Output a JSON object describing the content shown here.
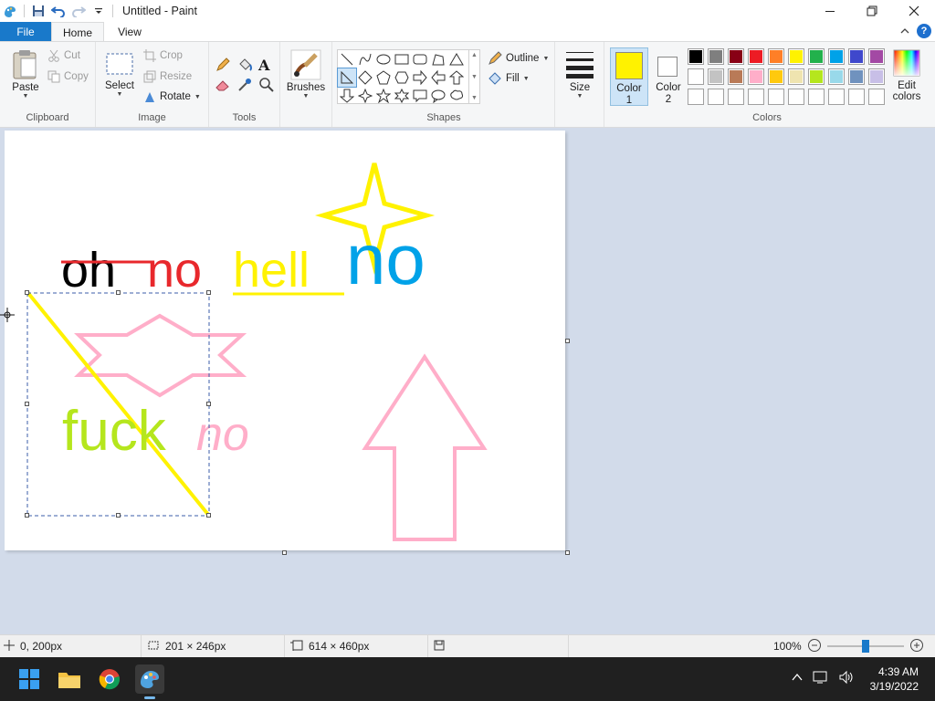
{
  "title_bar": {
    "title": "Untitled - Paint",
    "icons": [
      "paint-app-icon",
      "save-icon",
      "undo-icon",
      "redo-icon",
      "customize-qat-icon"
    ],
    "window_buttons": [
      "minimize-icon",
      "maximize-icon",
      "close-icon"
    ]
  },
  "tabs": {
    "file": "File",
    "home": "Home",
    "view": "View"
  },
  "ribbon": {
    "clipboard": {
      "label": "Clipboard",
      "paste": "Paste",
      "cut": "Cut",
      "copy": "Copy"
    },
    "image": {
      "label": "Image",
      "select": "Select",
      "crop": "Crop",
      "resize": "Resize",
      "rotate": "Rotate"
    },
    "tools": {
      "label": "Tools"
    },
    "brushes": {
      "label": "Brushes"
    },
    "shapes": {
      "label": "Shapes",
      "outline": "Outline",
      "fill": "Fill"
    },
    "size": {
      "label": "Size"
    },
    "colors": {
      "label": "Colors",
      "color1": "Color",
      "color1_num": "1",
      "color2": "Color",
      "color2_num": "2",
      "color1_value": "#fff200",
      "color2_value": "#ffffff",
      "edit": "Edit",
      "edit2": "colors",
      "palette_row1": [
        "#000000",
        "#7f7f7f",
        "#880015",
        "#ed1c24",
        "#ff7f27",
        "#fff200",
        "#22b14c",
        "#00a2e8",
        "#3f48cc",
        "#a349a4"
      ],
      "palette_row2": [
        "#ffffff",
        "#c3c3c3",
        "#b97a57",
        "#ffaec9",
        "#ffc90e",
        "#efe4b0",
        "#b5e61d",
        "#99d9ea",
        "#7092be",
        "#c8bfe7"
      ],
      "palette_row3": [
        "#ffffff",
        "#ffffff",
        "#ffffff",
        "#ffffff",
        "#ffffff",
        "#ffffff",
        "#ffffff",
        "#ffffff",
        "#ffffff",
        "#ffffff"
      ]
    }
  },
  "canvas_text": {
    "w1": "oh",
    "w2": "no",
    "w3": "hell",
    "w4": "no",
    "w5": "fuck",
    "w6": "no"
  },
  "status": {
    "cursor_pos": "0, 200px",
    "selection_size": "201 × 246px",
    "canvas_size": "614 × 460px",
    "zoom": "100%"
  },
  "taskbar": {
    "apps": [
      "start-icon",
      "file-explorer-icon",
      "chrome-icon",
      "paint-icon"
    ],
    "time": "4:39 AM",
    "date": "3/19/2022"
  }
}
